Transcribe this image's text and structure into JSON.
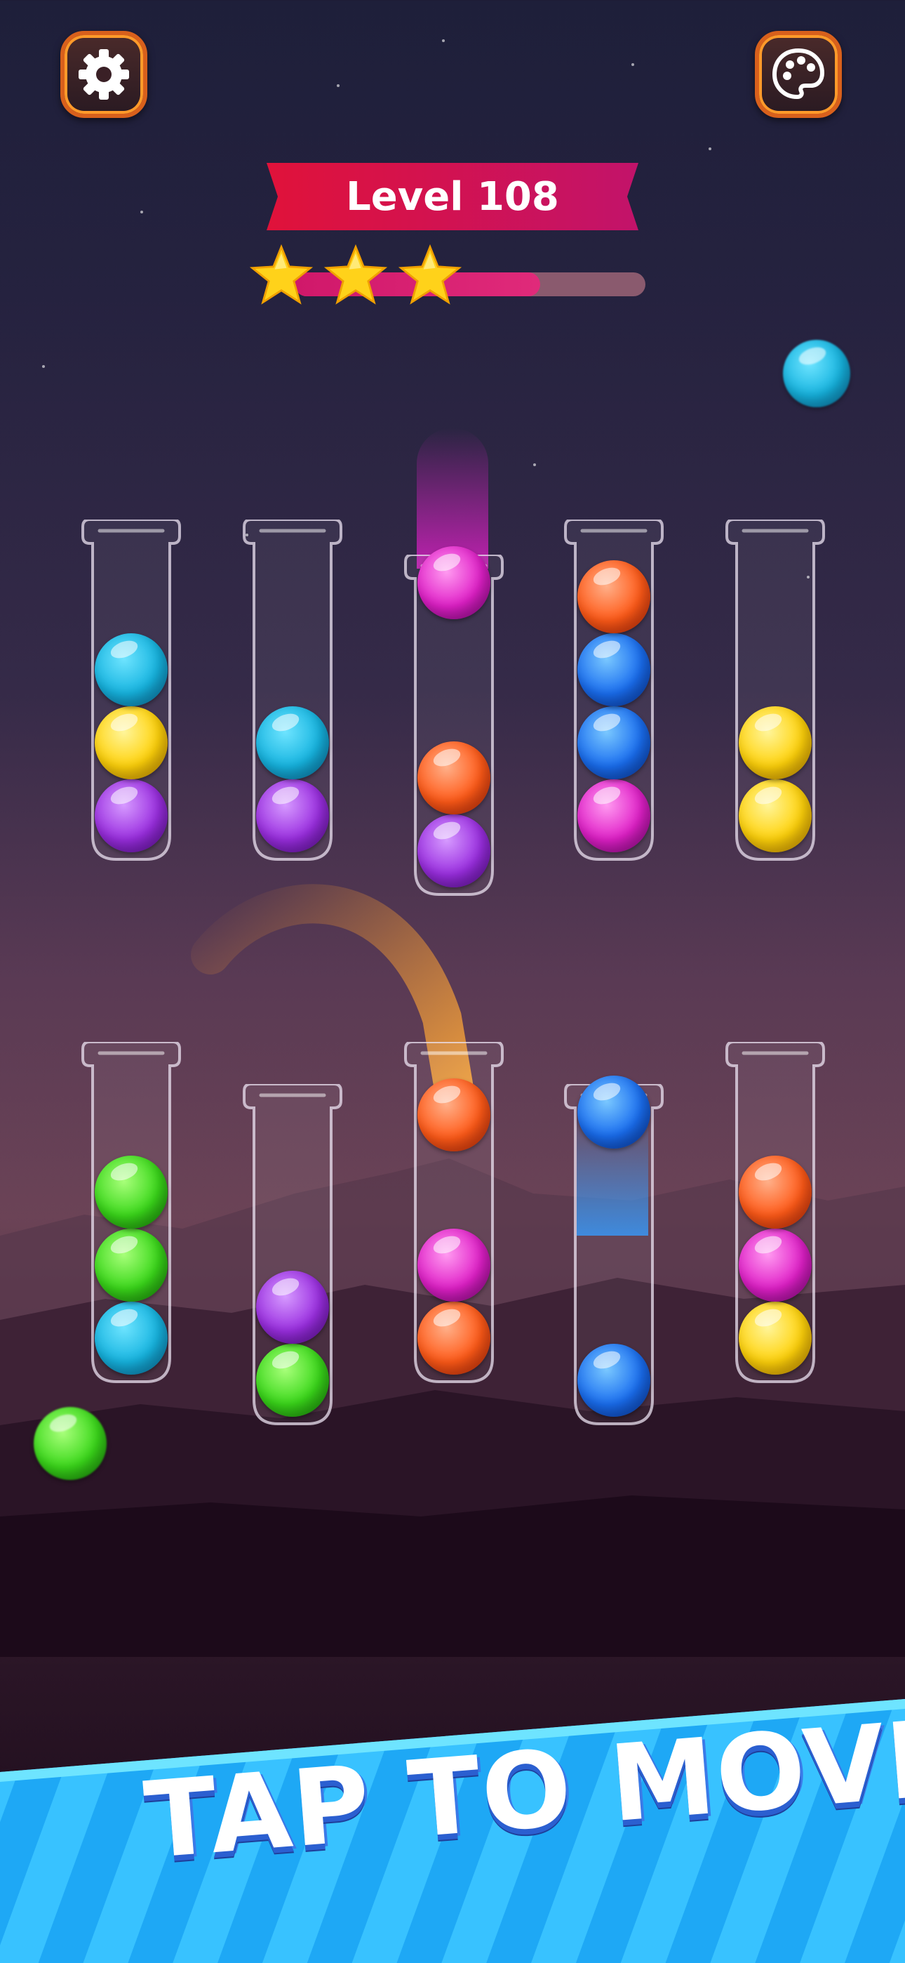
{
  "header": {
    "settings_icon": "gear-icon",
    "theme_icon": "palette-icon",
    "level_label": "Level 108",
    "stars_earned": 3,
    "progress_fraction": 0.7
  },
  "colors": {
    "banner_red": "#e0123a",
    "banner_magenta": "#c2136a",
    "accent_orange": "#ff8a1a",
    "banner_blue": "#2ab0ff"
  },
  "tubes": {
    "row1": [
      {
        "balls": [
          "purple",
          "yellow",
          "cyan"
        ]
      },
      {
        "balls": [
          "purple",
          "cyan"
        ]
      },
      {
        "balls": [
          "purple",
          "orange"
        ],
        "lifted": "magenta"
      },
      {
        "balls": [
          "magenta",
          "blue",
          "blue",
          "orange"
        ]
      },
      {
        "balls": [
          "yellow",
          "yellow"
        ]
      }
    ],
    "row2": [
      {
        "balls": [
          "cyan",
          "green",
          "green"
        ]
      },
      {
        "balls": [
          "green",
          "purple"
        ]
      },
      {
        "balls": [
          "orange",
          "magenta"
        ],
        "moving": "orange"
      },
      {
        "balls": [
          "blue"
        ],
        "lifted": "blue"
      },
      {
        "balls": [
          "yellow",
          "magenta",
          "orange"
        ]
      }
    ]
  },
  "cta": {
    "label": "TAP TO MOVE!"
  }
}
